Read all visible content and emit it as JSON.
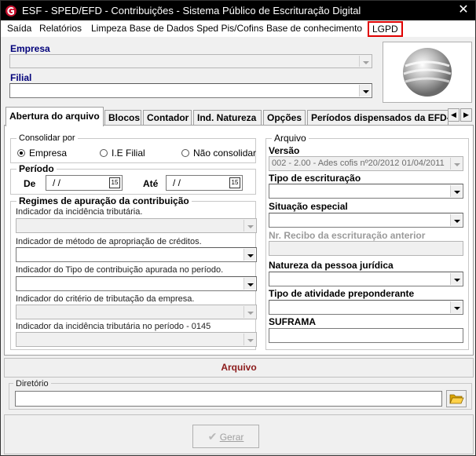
{
  "window": {
    "title": "ESF - SPED/EFD - Contribuições - Sistema Público de Escrituração Digital",
    "close_glyph": "✕"
  },
  "menu": {
    "items": [
      "Saída",
      "Relatórios",
      "Limpeza Base de Dados Sped Pis/Cofins",
      "Base de conhecimento",
      "LGPD"
    ]
  },
  "header": {
    "empresa_label": "Empresa",
    "filial_label": "Filial"
  },
  "tabs": [
    "Abertura do arquivo",
    "Blocos",
    "Contador",
    "Ind. Natureza",
    "Opções",
    "Períodos dispensados da EFD-"
  ],
  "consolidar": {
    "title": "Consolidar por",
    "options": [
      "Empresa",
      "I.E Filial",
      "Não consolidar"
    ],
    "selected": "Empresa"
  },
  "periodo": {
    "title": "Período",
    "de_label": "De",
    "ate_label": "Até",
    "de_value": "/ /",
    "ate_value": "/ /",
    "cal_glyph": "15"
  },
  "regimes": {
    "title": "Regimes de apuração da contribuição",
    "fields": [
      "Indicador da incidência tributária.",
      "Indicador de método de apropriação de créditos.",
      "Indicador do Tipo de contribuição apurada no período.",
      "Indicador do critério de tributação da empresa.",
      "Indicador da incidência tributária no período  - 0145"
    ]
  },
  "arquivo_group": {
    "title": "Arquivo",
    "versao_label": "Versão",
    "versao_value": "002 - 2.00 - Ades cofis nº20/2012  01/04/2011",
    "tipo_escrituracao_label": "Tipo de escrituração",
    "situacao_especial_label": "Situação especial",
    "nr_recibo_label": "Nr. Recibo da escrituração anterior",
    "natureza_label": "Natureza da pessoa jurídica",
    "tipo_atividade_label": "Tipo de atividade preponderante",
    "suframa_label": "SUFRAMA"
  },
  "arquivo_section": {
    "title": "Arquivo",
    "diretorio_label": "Diretório"
  },
  "actions": {
    "gerar_label": "Gerar"
  },
  "colors": {
    "titlebar": "#000000",
    "label_blue": "#00007a",
    "section_red": "#8b1a1a",
    "lgpd_highlight": "#e00000"
  }
}
